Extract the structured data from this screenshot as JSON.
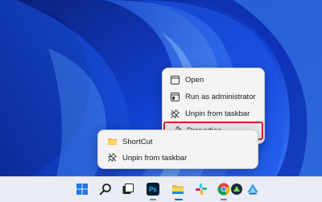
{
  "context_menu": {
    "items": [
      {
        "label": "Open",
        "icon": "window-icon"
      },
      {
        "label": "Run as administrator",
        "icon": "shield-window-icon"
      },
      {
        "label": "Unpin from taskbar",
        "icon": "unpin-icon"
      },
      {
        "label": "Properties",
        "icon": "wrench-icon"
      }
    ],
    "selected_item": "Properties",
    "highlight_color": "#d4202a"
  },
  "jump_list": {
    "items": [
      {
        "label": "ShortCut",
        "icon": "folder-icon"
      },
      {
        "label": "Unpin from taskbar",
        "icon": "unpin-icon"
      }
    ]
  },
  "taskbar": {
    "icons": [
      "start-icon",
      "search-icon",
      "task-view-icon",
      "photoshop-icon",
      "file-explorer-icon",
      "slack-icon",
      "chrome-icon",
      "app-icon",
      "cloud-app-icon"
    ],
    "photoshop_label": "Ps"
  },
  "colors": {
    "wallpaper_base": "#0a2fa8",
    "accent": "#0067c0"
  }
}
